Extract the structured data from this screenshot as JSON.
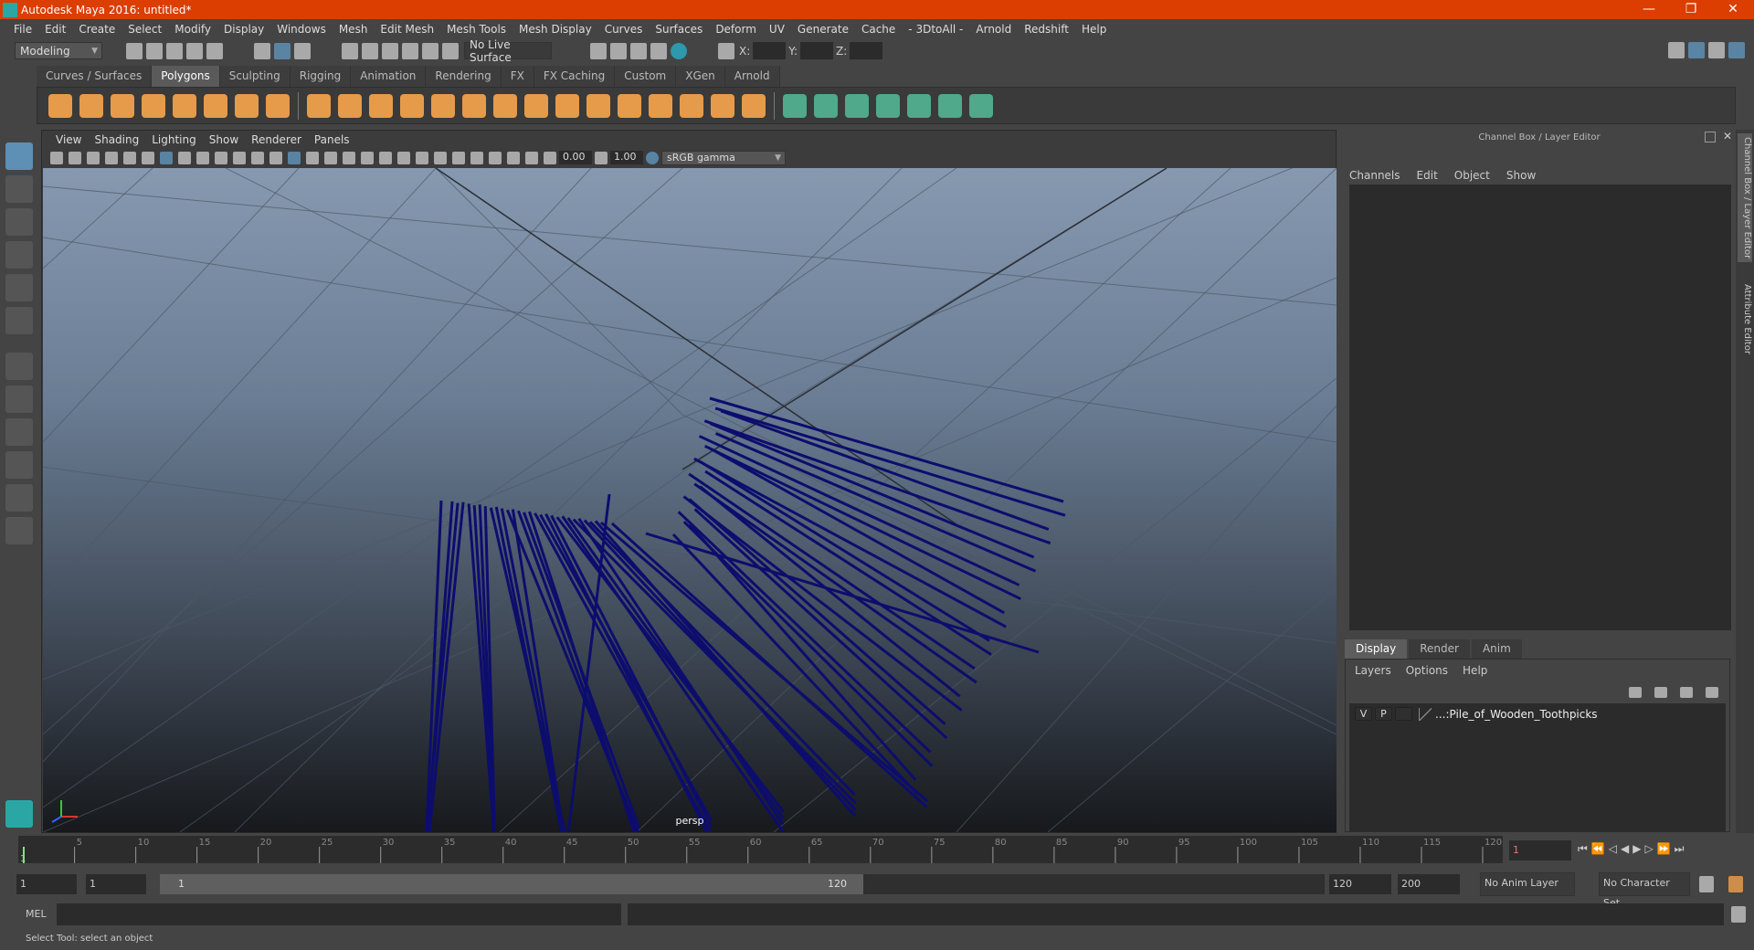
{
  "window": {
    "title": "Autodesk Maya 2016: untitled*",
    "minimize": "—",
    "restore": "❐",
    "close": "✕"
  },
  "menubar": [
    "File",
    "Edit",
    "Create",
    "Select",
    "Modify",
    "Display",
    "Windows",
    "Mesh",
    "Edit Mesh",
    "Mesh Tools",
    "Mesh Display",
    "Curves",
    "Surfaces",
    "Deform",
    "UV",
    "Generate",
    "Cache",
    "- 3DtoAll -",
    "Arnold",
    "Redshift",
    "Help"
  ],
  "statusline": {
    "mode": "Modeling",
    "live_surface": "No Live Surface",
    "x_label": "X:",
    "y_label": "Y:",
    "z_label": "Z:"
  },
  "shelf": {
    "tabs": [
      "Curves / Surfaces",
      "Polygons",
      "Sculpting",
      "Rigging",
      "Animation",
      "Rendering",
      "FX",
      "FX Caching",
      "Custom",
      "XGen",
      "Arnold"
    ],
    "active": "Polygons"
  },
  "viewport": {
    "menu": [
      "View",
      "Shading",
      "Lighting",
      "Show",
      "Renderer",
      "Panels"
    ],
    "exposure": "0.00",
    "gamma": "1.00",
    "color_space": "sRGB gamma",
    "camera": "persp",
    "wire_color": "#0d0d6e"
  },
  "channel_box": {
    "title": "Channel Box / Layer Editor",
    "menu": [
      "Channels",
      "Edit",
      "Object",
      "Show"
    ]
  },
  "layer_editor": {
    "tabs": [
      "Display",
      "Render",
      "Anim"
    ],
    "active": "Display",
    "menu": [
      "Layers",
      "Options",
      "Help"
    ],
    "layers": [
      {
        "v": "V",
        "p": "P",
        "name": "...:Pile_of_Wooden_Toothpicks"
      }
    ]
  },
  "side_tabs": [
    "Channel Box / Layer Editor",
    "Attribute Editor"
  ],
  "timeline": {
    "ticks": [
      "5",
      "10",
      "15",
      "20",
      "25",
      "30",
      "35",
      "40",
      "45",
      "50",
      "55",
      "60",
      "65",
      "70",
      "75",
      "80",
      "85",
      "90",
      "95",
      "100",
      "105",
      "110",
      "115",
      "120"
    ],
    "start_marker": "1",
    "current_frame": "1"
  },
  "range": {
    "start": "1",
    "playback_start": "1",
    "slider_start": "1",
    "slider_end": "120",
    "playback_end": "120",
    "end": "200",
    "anim_layer": "No Anim Layer",
    "character_set": "No Character Set"
  },
  "command": {
    "label": "MEL"
  },
  "help_line": "Select Tool: select an object"
}
